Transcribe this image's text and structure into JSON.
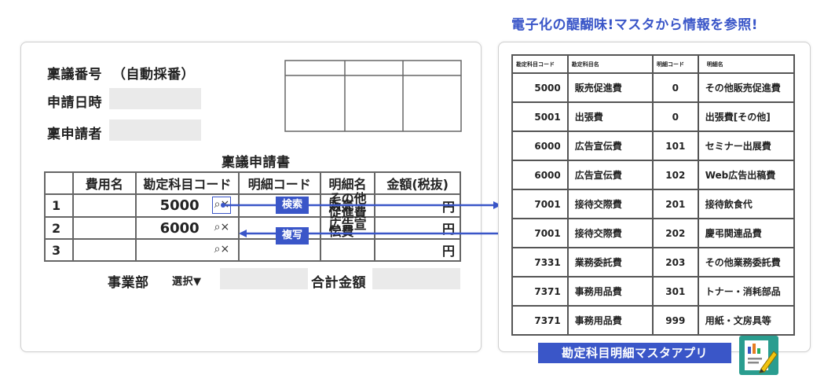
{
  "headline": "電子化の醍醐味!マスタから情報を参照!",
  "form": {
    "ringi_number_label": "稟議番号",
    "ringi_number_value": "（自動採番）",
    "date_label": "申請日時",
    "applicant_label": "稟申請者",
    "title": "稟議申請書",
    "columns": [
      "",
      "費用名",
      "勘定科目コード",
      "明細コード",
      "明細名",
      "金額(税抜)"
    ],
    "rows": [
      {
        "no": "1",
        "code": "5000",
        "detail_name": "その他販売\n促進費",
        "yen": "円"
      },
      {
        "no": "2",
        "code": "6000",
        "detail_name": "広告宣伝費",
        "yen": "円"
      },
      {
        "no": "3",
        "code": "",
        "detail_name": "",
        "yen": "円"
      }
    ],
    "search_clear": "⌕×",
    "department_label": "事業部",
    "select_label": "選択▼",
    "total_label": "合計金額"
  },
  "actions": {
    "search": "検索",
    "copy": "複写"
  },
  "master": {
    "columns": [
      "勘定科目コード",
      "勘定科目名",
      "明細コード",
      "明細名"
    ],
    "rows": [
      [
        "5000",
        "販売促進費",
        "0",
        "その他販売促進費"
      ],
      [
        "5001",
        "出張費",
        "0",
        "出張費[その他]"
      ],
      [
        "6000",
        "広告宣伝費",
        "101",
        "セミナー出展費"
      ],
      [
        "6000",
        "広告宣伝費",
        "102",
        "Web広告出稿費"
      ],
      [
        "7001",
        "接待交際費",
        "201",
        "接待飲食代"
      ],
      [
        "7001",
        "接待交際費",
        "202",
        "慶弔関連品費"
      ],
      [
        "7331",
        "業務委託費",
        "203",
        "その他業務委託費"
      ],
      [
        "7371",
        "事務用品費",
        "301",
        "トナー・消耗部品"
      ],
      [
        "7371",
        "事務用品費",
        "999",
        "用紙・文房具等"
      ]
    ],
    "app_label": "勘定科目明細マスタアプリ"
  },
  "colors": {
    "accent": "#3a56c8",
    "field": "#eaeaea",
    "app_icon": "#2a9d8f"
  }
}
